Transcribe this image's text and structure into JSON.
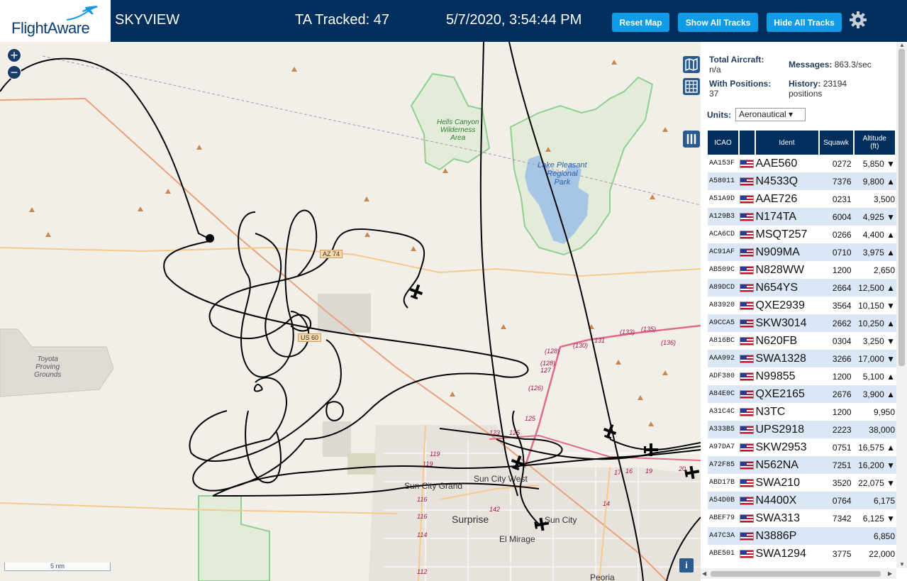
{
  "header": {
    "logo_text": "FlightAware",
    "title": "SKYVIEW",
    "tracked": "TA Tracked: 47",
    "datetime": "5/7/2020, 3:54:44 PM",
    "buttons": {
      "reset": "Reset Map",
      "show_all": "Show All Tracks",
      "hide_all": "Hide All Tracks"
    },
    "settings_icon": "gear-icon"
  },
  "map": {
    "zoom_in": "+",
    "zoom_out": "−",
    "scale": "5 nm",
    "info": "i",
    "labels": {
      "hells_canyon": [
        "Hells Canyon",
        "Wilderness",
        "Area"
      ],
      "lake_pleasant": [
        "Lake Pleasant",
        "Regional",
        "Park"
      ],
      "toyota": [
        "Toyota",
        "Proving",
        "Grounds"
      ],
      "sun_city_grand": "Sun City Grand",
      "sun_city_west": "Sun City West",
      "surprise": "Surprise",
      "sun_city": "Sun City",
      "el_mirage": "El Mirage",
      "peoria": "Peoria",
      "az74": "AZ 74",
      "us60": "US 60"
    },
    "routes": [
      "(128)",
      "(128)",
      "127",
      "(126)",
      "125",
      "(130)",
      "131",
      "(133)",
      "(135)",
      "(136)",
      "119",
      "119",
      "116",
      "116",
      "114",
      "112",
      "142",
      "14",
      "16",
      "17",
      "19",
      "20",
      "123",
      "125"
    ]
  },
  "sidebar": {
    "total_aircraft_label": "Total Aircraft:",
    "total_aircraft_value": "n/a",
    "with_positions_label": "With Positions:",
    "with_positions_value": "37",
    "messages_label": "Messages:",
    "messages_value": "863.3/sec",
    "history_label": "History:",
    "history_value": "23194",
    "history_unit": "positions",
    "units_label": "Units:",
    "units_value": "Aeronautical ▾",
    "columns": {
      "icao": "ICAO",
      "ident": "Ident",
      "squawk": "Squawk",
      "altitude": "Altitude",
      "altitude_unit": "(ft)"
    },
    "rows": [
      {
        "icao": "AA153F",
        "ident": "AAE560",
        "squawk": "0272",
        "alt": "5,850 ▼"
      },
      {
        "icao": "A58011",
        "ident": "N4533Q",
        "squawk": "7376",
        "alt": "9,800 ▲"
      },
      {
        "icao": "A51A9D",
        "ident": "AAE726",
        "squawk": "0231",
        "alt": "3,500"
      },
      {
        "icao": "A129B3",
        "ident": "N174TA",
        "squawk": "6004",
        "alt": "4,925 ▼"
      },
      {
        "icao": "ACA6CD",
        "ident": "MSQT257",
        "squawk": "0266",
        "alt": "4,400 ▲"
      },
      {
        "icao": "AC91AF",
        "ident": "N909MA",
        "squawk": "0710",
        "alt": "3,975 ▲"
      },
      {
        "icao": "AB509C",
        "ident": "N828WW",
        "squawk": "1200",
        "alt": "2,650"
      },
      {
        "icao": "A89DCD",
        "ident": "N654YS",
        "squawk": "2664",
        "alt": "12,500 ▲"
      },
      {
        "icao": "A83920",
        "ident": "QXE2939",
        "squawk": "3564",
        "alt": "10,150 ▼"
      },
      {
        "icao": "A9CCA5",
        "ident": "SKW3014",
        "squawk": "2662",
        "alt": "10,250 ▲"
      },
      {
        "icao": "A816BC",
        "ident": "N620FB",
        "squawk": "0304",
        "alt": "3,250 ▼"
      },
      {
        "icao": "AAA992",
        "ident": "SWA1328",
        "squawk": "3266",
        "alt": "17,000 ▼"
      },
      {
        "icao": "ADF380",
        "ident": "N99855",
        "squawk": "1200",
        "alt": "5,100 ▲"
      },
      {
        "icao": "A84E0C",
        "ident": "QXE2165",
        "squawk": "2676",
        "alt": "3,900 ▲"
      },
      {
        "icao": "A31C4C",
        "ident": "N3TC",
        "squawk": "1200",
        "alt": "9,950"
      },
      {
        "icao": "A333B5",
        "ident": "UPS2918",
        "squawk": "2223",
        "alt": "38,000"
      },
      {
        "icao": "A97DA7",
        "ident": "SKW2953",
        "squawk": "0751",
        "alt": "16,575 ▲"
      },
      {
        "icao": "A72F85",
        "ident": "N562NA",
        "squawk": "7251",
        "alt": "16,200 ▼"
      },
      {
        "icao": "ABD17B",
        "ident": "SWA210",
        "squawk": "3520",
        "alt": "22,075 ▼"
      },
      {
        "icao": "A54D0B",
        "ident": "N4400X",
        "squawk": "0764",
        "alt": "6,175"
      },
      {
        "icao": "ABEF79",
        "ident": "SWA313",
        "squawk": "7342",
        "alt": "6,125 ▼"
      },
      {
        "icao": "A47C3A",
        "ident": "N3886P",
        "squawk": "",
        "alt": "6,850"
      },
      {
        "icao": "ABE501",
        "ident": "SWA1294",
        "squawk": "3775",
        "alt": "22,000"
      }
    ]
  }
}
